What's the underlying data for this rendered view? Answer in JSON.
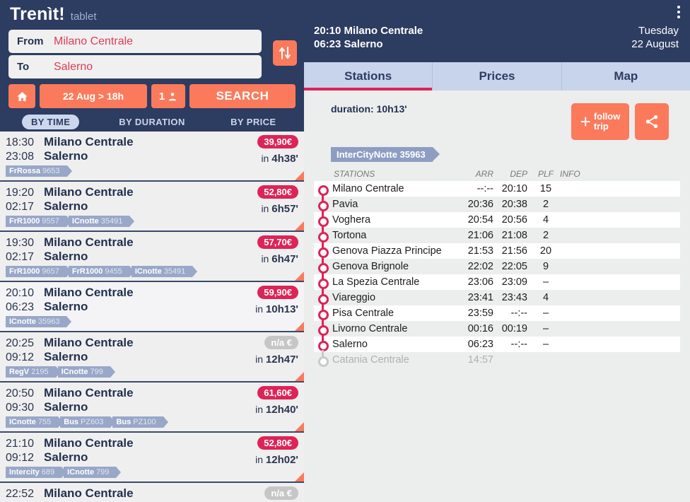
{
  "brand": {
    "name": "Trenìt!",
    "subtitle": "tablet"
  },
  "search": {
    "from_label": "From",
    "from_value": "Milano Centrale",
    "to_label": "To",
    "to_value": "Salerno",
    "swap_icon": "swap-vertical-icon",
    "home_icon": "home-icon",
    "date_label": "22 Aug > 18h",
    "passengers_label": "1",
    "passenger_icon": "person-icon",
    "search_label": "SEARCH"
  },
  "sort_tabs": [
    {
      "label": "BY TIME",
      "active": true
    },
    {
      "label": "BY DURATION",
      "active": false
    },
    {
      "label": "BY PRICE",
      "active": false
    }
  ],
  "results": [
    {
      "dep_time": "18:30",
      "dep_place": "Milano Centrale",
      "arr_time": "23:08",
      "arr_place": "Salerno",
      "price": "39,90€",
      "na": false,
      "in_label": "in",
      "duration": "4h38'",
      "tags": [
        {
          "name": "FrRossa",
          "num": "9653"
        }
      ],
      "selected": false
    },
    {
      "dep_time": "19:20",
      "dep_place": "Milano Centrale",
      "arr_time": "02:17",
      "arr_place": "Salerno",
      "price": "52,80€",
      "na": false,
      "in_label": "in",
      "duration": "6h57'",
      "tags": [
        {
          "name": "FrR1000",
          "num": "9557"
        },
        {
          "name": "ICnotte",
          "num": "35491"
        }
      ],
      "selected": false
    },
    {
      "dep_time": "19:30",
      "dep_place": "Milano Centrale",
      "arr_time": "02:17",
      "arr_place": "Salerno",
      "price": "57,70€",
      "na": false,
      "in_label": "in",
      "duration": "6h47'",
      "tags": [
        {
          "name": "FrR1000",
          "num": "9657"
        },
        {
          "name": "FrR1000",
          "num": "9455"
        },
        {
          "name": "ICnotte",
          "num": "35491"
        }
      ],
      "selected": false
    },
    {
      "dep_time": "20:10",
      "dep_place": "Milano Centrale",
      "arr_time": "06:23",
      "arr_place": "Salerno",
      "price": "59,90€",
      "na": false,
      "in_label": "in",
      "duration": "10h13'",
      "tags": [
        {
          "name": "ICnotte",
          "num": "35963"
        }
      ],
      "selected": true
    },
    {
      "dep_time": "20:25",
      "dep_place": "Milano Centrale",
      "arr_time": "09:12",
      "arr_place": "Salerno",
      "price": "n/a €",
      "na": true,
      "in_label": "in",
      "duration": "12h47'",
      "tags": [
        {
          "name": "RegV",
          "num": "2195"
        },
        {
          "name": "ICnotte",
          "num": "799"
        }
      ],
      "selected": false
    },
    {
      "dep_time": "20:50",
      "dep_place": "Milano Centrale",
      "arr_time": "09:30",
      "arr_place": "Salerno",
      "price": "61,60€",
      "na": false,
      "in_label": "in",
      "duration": "12h40'",
      "tags": [
        {
          "name": "ICnotte",
          "num": "755"
        },
        {
          "name": "Bus",
          "num": "PZ603"
        },
        {
          "name": "Bus",
          "num": "PZ100"
        }
      ],
      "selected": false
    },
    {
      "dep_time": "21:10",
      "dep_place": "Milano Centrale",
      "arr_time": "09:12",
      "arr_place": "Salerno",
      "price": "52,80€",
      "na": false,
      "in_label": "in",
      "duration": "12h02'",
      "tags": [
        {
          "name": "Intercity",
          "num": "689"
        },
        {
          "name": "ICnotte",
          "num": "799"
        }
      ],
      "selected": false
    },
    {
      "dep_time": "22:52",
      "dep_place": "Milano Centrale",
      "arr_time": "",
      "arr_place": "",
      "price": "n/a €",
      "na": true,
      "in_label": "",
      "duration": "",
      "tags": [],
      "selected": false,
      "partial": true
    }
  ],
  "detail": {
    "header": {
      "dep_line": "20:10 Milano Centrale",
      "arr_line": "06:23 Salerno",
      "weekday": "Tuesday",
      "date": "22 August",
      "menu_icon": "kebab-menu-icon"
    },
    "tabs": [
      {
        "label": "Stations",
        "active": true
      },
      {
        "label": "Prices",
        "active": false
      },
      {
        "label": "Map",
        "active": false
      }
    ],
    "duration_text": "duration: 10h13'",
    "follow_trip_label": "follow\ntrip",
    "follow_trip_line1": "follow",
    "follow_trip_line2": "trip",
    "plus_icon": "plus-icon",
    "share_icon": "share-icon",
    "train_tag": "InterCityNotte 35963",
    "columns": {
      "stations": "STATIONS",
      "arr": "ARR",
      "dep": "DEP",
      "plf": "PLF",
      "info": "INFO"
    },
    "stops": [
      {
        "station": "Milano Centrale",
        "arr": "--:--",
        "dep": "20:10",
        "plf": "15",
        "info": "",
        "arr_muted": true,
        "dep_muted": false,
        "dim": false
      },
      {
        "station": "Pavia",
        "arr": "20:36",
        "dep": "20:38",
        "plf": "2",
        "info": "",
        "arr_muted": false,
        "dep_muted": false,
        "dim": false
      },
      {
        "station": "Voghera",
        "arr": "20:54",
        "dep": "20:56",
        "plf": "4",
        "info": "",
        "arr_muted": false,
        "dep_muted": false,
        "dim": false
      },
      {
        "station": "Tortona",
        "arr": "21:06",
        "dep": "21:08",
        "plf": "2",
        "info": "",
        "arr_muted": false,
        "dep_muted": false,
        "dim": false
      },
      {
        "station": "Genova Piazza Principe",
        "arr": "21:53",
        "dep": "21:56",
        "plf": "20",
        "info": "",
        "arr_muted": false,
        "dep_muted": false,
        "dim": false
      },
      {
        "station": "Genova Brignole",
        "arr": "22:02",
        "dep": "22:05",
        "plf": "9",
        "info": "",
        "arr_muted": false,
        "dep_muted": false,
        "dim": false
      },
      {
        "station": "La Spezia Centrale",
        "arr": "23:06",
        "dep": "23:09",
        "plf": "–",
        "info": "",
        "arr_muted": false,
        "dep_muted": false,
        "dim": false
      },
      {
        "station": "Viareggio",
        "arr": "23:41",
        "dep": "23:43",
        "plf": "4",
        "info": "",
        "arr_muted": false,
        "dep_muted": false,
        "dim": false
      },
      {
        "station": "Pisa Centrale",
        "arr": "23:59",
        "dep": "--:--",
        "plf": "–",
        "info": "",
        "arr_muted": false,
        "dep_muted": true,
        "dim": false
      },
      {
        "station": "Livorno Centrale",
        "arr": "00:16",
        "dep": "00:19",
        "plf": "–",
        "info": "",
        "arr_muted": false,
        "dep_muted": false,
        "dim": false
      },
      {
        "station": "Salerno",
        "arr": "06:23",
        "dep": "--:--",
        "plf": "–",
        "info": "",
        "arr_muted": false,
        "dep_muted": true,
        "dim": false
      },
      {
        "station": "Catania Centrale",
        "arr": "14:57",
        "dep": "",
        "plf": "",
        "info": "",
        "arr_muted": false,
        "dep_muted": false,
        "dim": true
      }
    ]
  },
  "colors": {
    "navy": "#2d3c61",
    "orange": "#fb7a5c",
    "crimson": "#dd2457",
    "tag_blue": "#99a7c8",
    "tab_bg": "#c8d4ec"
  }
}
